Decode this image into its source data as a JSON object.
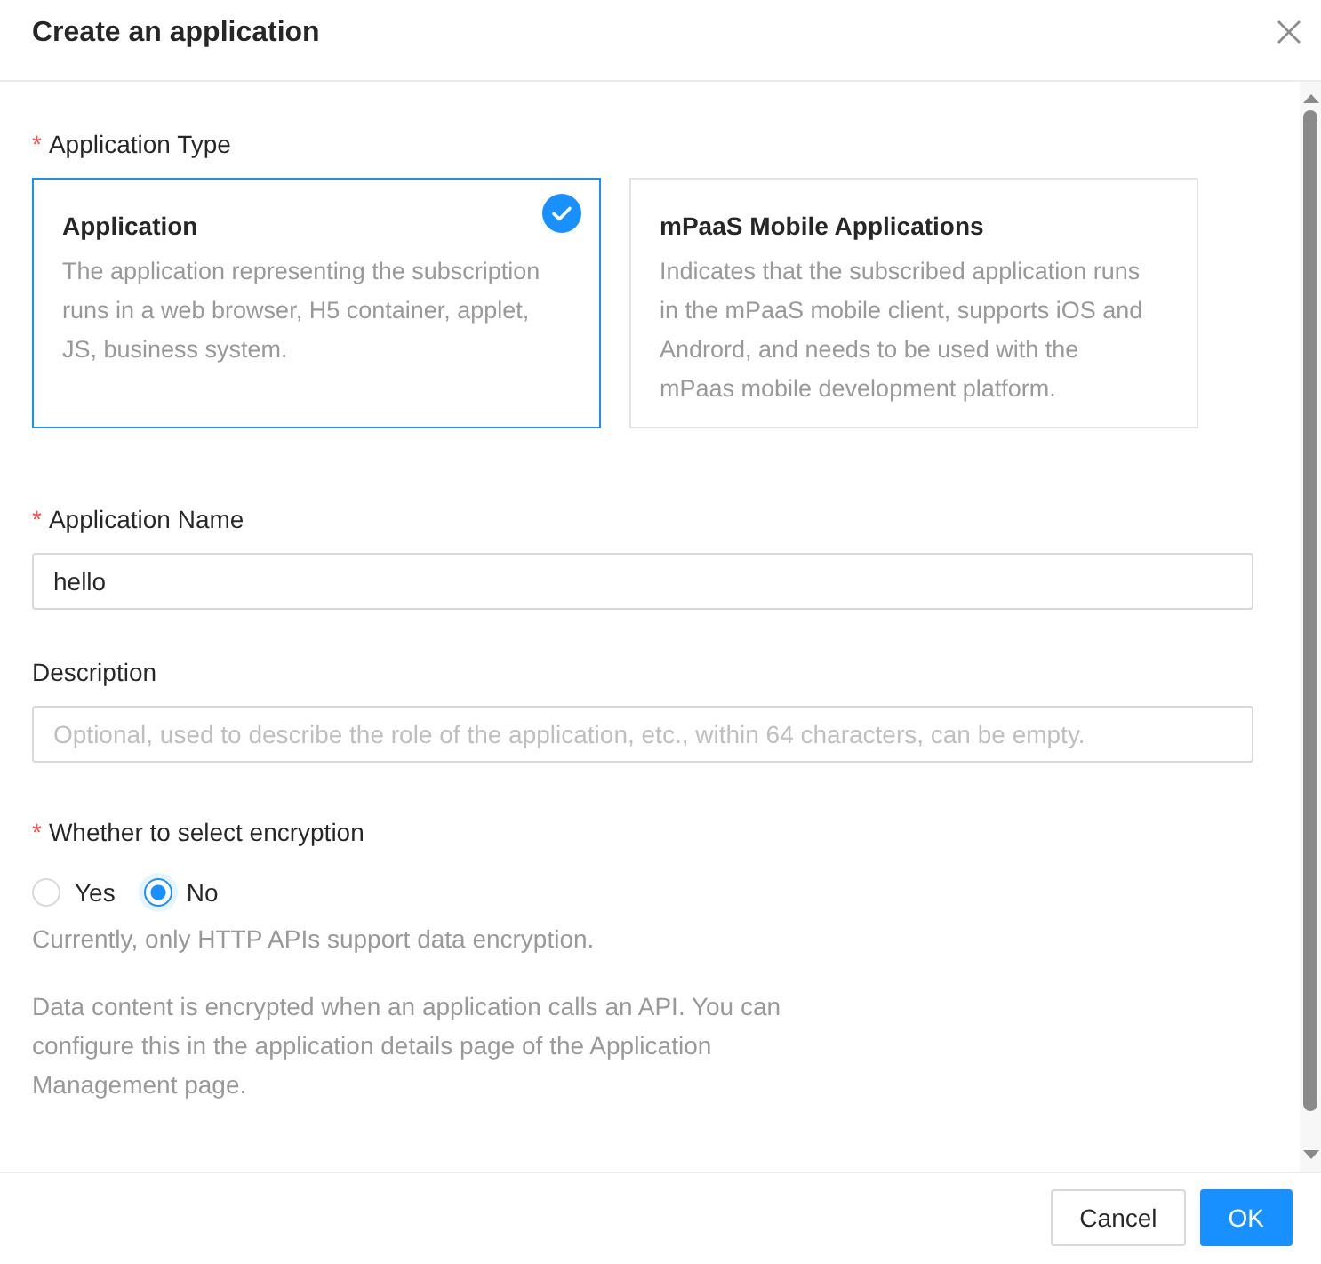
{
  "dialog": {
    "title": "Create an application"
  },
  "form": {
    "application_type": {
      "label": "Application Type",
      "required_mark": "*",
      "options": [
        {
          "title": "Application",
          "description": "The application representing the subscription runs in a web browser, H5 container, applet, JS, business system.",
          "selected": true
        },
        {
          "title": "mPaaS Mobile Applications",
          "description": "Indicates that the subscribed application runs in the mPaaS mobile client, supports iOS and Andrord, and needs to be used with the mPaas mobile development platform.",
          "selected": false
        }
      ]
    },
    "application_name": {
      "label": "Application Name",
      "required_mark": "*",
      "value": "hello"
    },
    "description": {
      "label": "Description",
      "placeholder": "Optional, used to describe the role of the application, etc., within 64 characters, can be empty."
    },
    "encryption": {
      "label": "Whether to select encryption",
      "required_mark": "*",
      "options": [
        {
          "label": "Yes",
          "selected": false
        },
        {
          "label": "No",
          "selected": true
        }
      ],
      "help": "Currently, only HTTP APIs support data encryption.",
      "note": "Data content is encrypted when an application calls an API. You can configure this in the application details page of the Application Management page."
    }
  },
  "buttons": [
    {
      "label": "Cancel",
      "kind": "default"
    },
    {
      "label": "OK",
      "kind": "primary"
    }
  ]
}
